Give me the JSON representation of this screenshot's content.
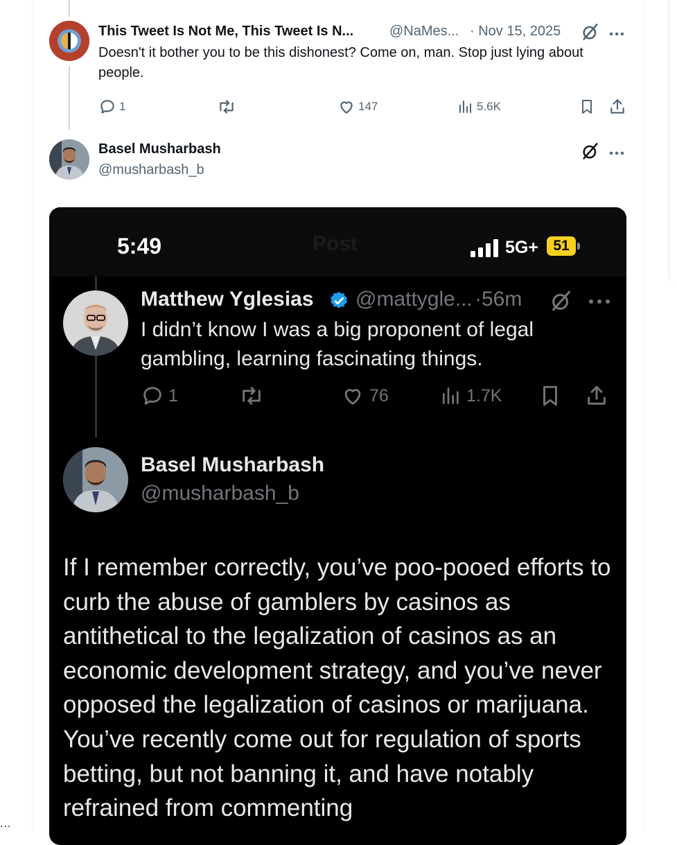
{
  "reply_tweet": {
    "author_name": "This Tweet Is Not Me, This Tweet Is N...",
    "author_handle": "@NaMes...",
    "date": "· Nov 15, 2025",
    "text": "Doesn't it bother you to be this dishonest? Come on, man. Stop just lying about people.",
    "replies": "1",
    "likes": "147",
    "views": "5.6K"
  },
  "quote_tweet": {
    "author_name": "Basel Musharbash",
    "author_handle": "@musharbash_b"
  },
  "screenshot": {
    "status_time": "5:49",
    "network": "5G+",
    "battery": "51",
    "header_ghost": "Post",
    "tweet1": {
      "author_name": "Matthew Yglesias",
      "author_handle": "@mattygle...",
      "time": "·56m",
      "text": "I didn’t know I was a big proponent of legal gambling, learning fascinating things.",
      "replies": "1",
      "likes": "76",
      "views": "1.7K"
    },
    "tweet2": {
      "author_name": "Basel Musharbash",
      "author_handle": "@musharbash_b",
      "text": "If I remember correctly, you’ve poo-pooed efforts to curb the abuse of gamblers by casinos as antithetical to the legalization of casinos as an economic development strategy, and you’ve never opposed the legalization of casinos or marijuana. You’ve recently come out for regulation of sports betting, but not banning it, and have notably refrained from commenting"
    }
  },
  "page_edge": {
    "left_overflow": "..."
  },
  "colors": {
    "text_primary": "#0f1419",
    "text_secondary": "#536471",
    "verified_blue": "#1d9bf0",
    "battery_yellow": "#f5d020"
  }
}
